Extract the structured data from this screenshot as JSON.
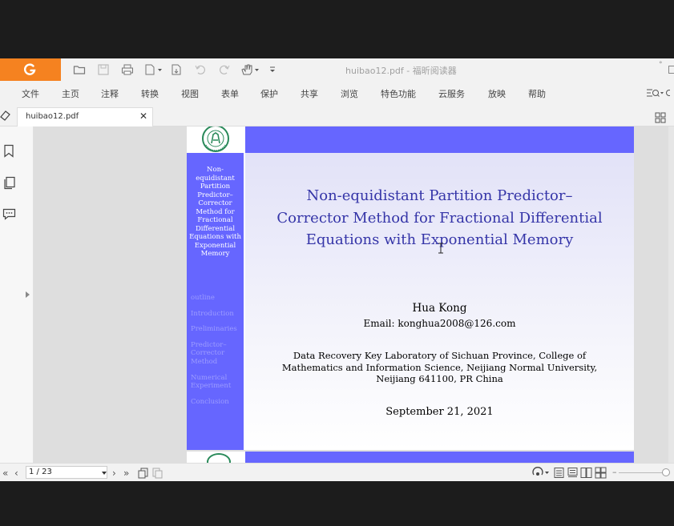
{
  "window": {
    "title": "huibao12.pdf - 福昕阅读器"
  },
  "menu": {
    "items": [
      "文件",
      "主页",
      "注释",
      "转换",
      "视图",
      "表单",
      "保护",
      "共享",
      "浏览",
      "特色功能",
      "云服务",
      "放映",
      "帮助"
    ]
  },
  "tab": {
    "label": "huibao12.pdf",
    "close": "✕"
  },
  "slide": {
    "side_title": "Non-equidistant Partition Predictor–Corrector Method for Fractional Differential Equations with Exponential Memory",
    "nav": {
      "outline": "outline",
      "introduction": "Introduction",
      "preliminaries": "Preliminaries",
      "method": "Predictor–Corrector Method",
      "numerical": "Numerical Experiment",
      "conclusion": "Conclusion"
    },
    "title": "Non-equidistant Partition Predictor–Corrector Method for Fractional Differential Equations with Exponential Memory",
    "author": "Hua Kong",
    "email": "Email: konghua2008@126.com",
    "affiliation": "Data Recovery Key Laboratory of Sichuan Province, College of Mathematics and Information Science, Neijiang Normal University, Neijiang 641100, PR China",
    "date": "September 21, 2021"
  },
  "status": {
    "page_indicator": "1 / 23"
  },
  "colors": {
    "brand": "#f58220",
    "beamer_blue": "#6666ff",
    "title_text": "#3535a8"
  }
}
